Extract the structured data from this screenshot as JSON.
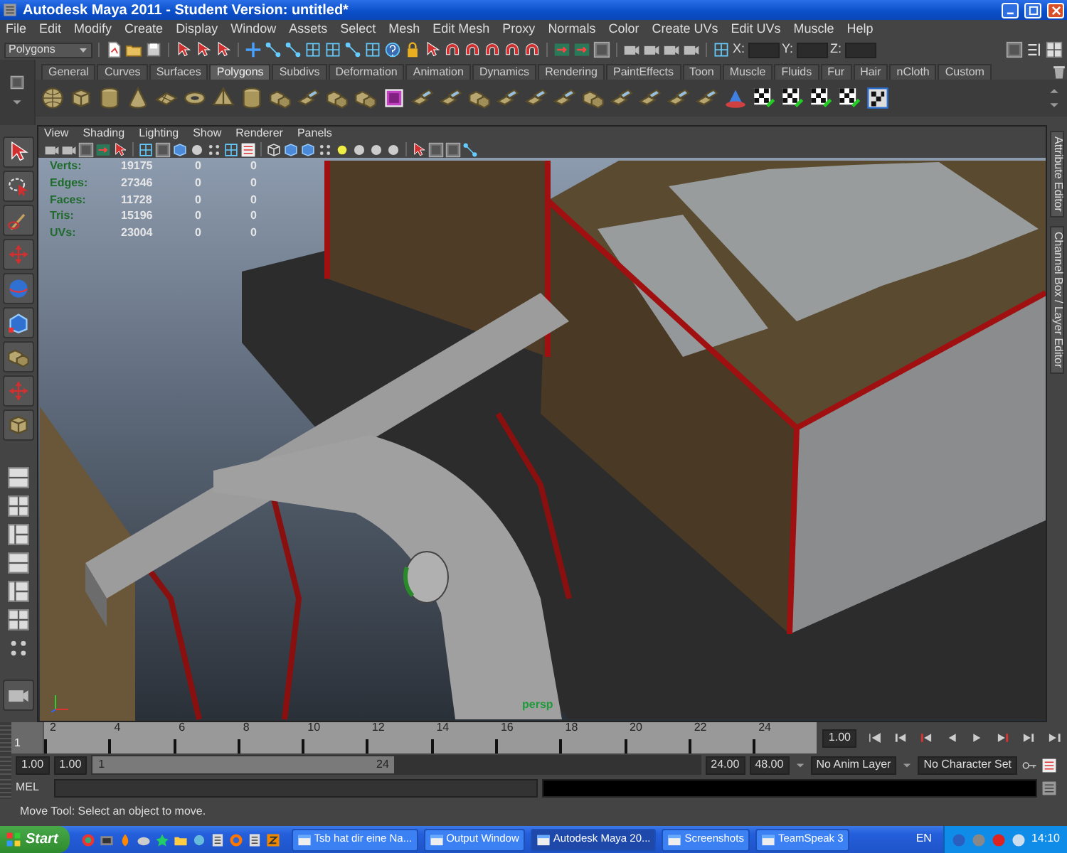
{
  "window": {
    "title": "Autodesk Maya 2011 - Student Version: untitled*"
  },
  "menu": [
    "File",
    "Edit",
    "Modify",
    "Create",
    "Display",
    "Window",
    "Assets",
    "Select",
    "Mesh",
    "Edit Mesh",
    "Proxy",
    "Normals",
    "Color",
    "Create UVs",
    "Edit UVs",
    "Muscle",
    "Help"
  ],
  "status_line": {
    "mode": "Polygons",
    "x_label": "X:",
    "y_label": "Y:",
    "z_label": "Z:"
  },
  "shelf": {
    "tabs": [
      {
        "label": "General",
        "selected": false
      },
      {
        "label": "Curves",
        "selected": false
      },
      {
        "label": "Surfaces",
        "selected": false
      },
      {
        "label": "Polygons",
        "selected": true
      },
      {
        "label": "Subdivs",
        "selected": false
      },
      {
        "label": "Deformation",
        "selected": false
      },
      {
        "label": "Animation",
        "selected": false
      },
      {
        "label": "Dynamics",
        "selected": false
      },
      {
        "label": "Rendering",
        "selected": false
      },
      {
        "label": "PaintEffects",
        "selected": false
      },
      {
        "label": "Toon",
        "selected": false
      },
      {
        "label": "Muscle",
        "selected": false
      },
      {
        "label": "Fluids",
        "selected": false
      },
      {
        "label": "Fur",
        "selected": false
      },
      {
        "label": "Hair",
        "selected": false
      },
      {
        "label": "nCloth",
        "selected": false
      },
      {
        "label": "Custom",
        "selected": false
      }
    ]
  },
  "viewport": {
    "menu": [
      "View",
      "Shading",
      "Lighting",
      "Show",
      "Renderer",
      "Panels"
    ],
    "stats": [
      {
        "label": "Verts:",
        "values": [
          "19175",
          "0",
          "0"
        ]
      },
      {
        "label": "Edges:",
        "values": [
          "27346",
          "0",
          "0"
        ]
      },
      {
        "label": "Faces:",
        "values": [
          "11728",
          "0",
          "0"
        ]
      },
      {
        "label": "Tris:",
        "values": [
          "15196",
          "0",
          "0"
        ]
      },
      {
        "label": "UVs:",
        "values": [
          "23004",
          "0",
          "0"
        ]
      }
    ],
    "camera": "persp"
  },
  "side_tabs": [
    "Attribute Editor",
    "Channel Box / Layer Editor"
  ],
  "time_slider": {
    "current_frame": "1",
    "level": 0,
    "ticks": [
      "2",
      "4",
      "6",
      "8",
      "10",
      "12",
      "14",
      "16",
      "18",
      "20",
      "22",
      "24"
    ],
    "frame_field": "1.00"
  },
  "range_slider": {
    "level": 0.5,
    "start": "1.00",
    "min": "1.00",
    "range_start": "1",
    "range_end": "24",
    "max": "24.00",
    "end": "48.00",
    "anim_layer": "No Anim Layer",
    "character_set": "No Character Set"
  },
  "command_line": {
    "language": "MEL"
  },
  "help_line": "Move Tool: Select an object to move.",
  "taskbar": {
    "start": "Start",
    "tasks": [
      {
        "label": "Tsb hat dir eine Na...",
        "selected": false
      },
      {
        "label": "Output Window",
        "selected": false
      },
      {
        "label": "Autodesk Maya 20...",
        "selected": true
      },
      {
        "label": "Screenshots",
        "selected": false
      },
      {
        "label": "TeamSpeak 3",
        "selected": false
      }
    ],
    "language": "EN",
    "clock": "14:10"
  }
}
